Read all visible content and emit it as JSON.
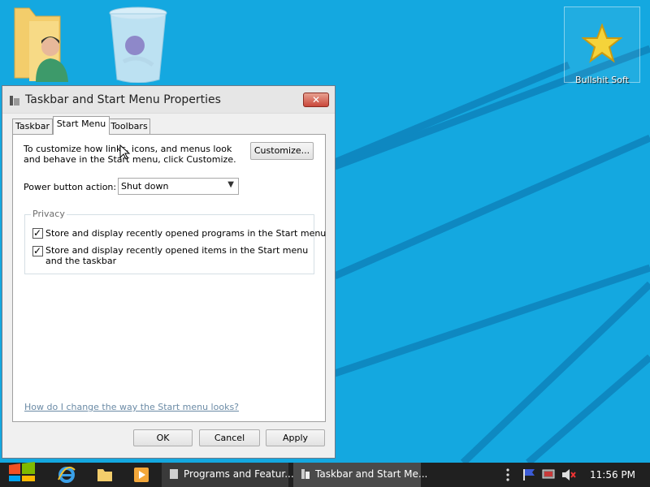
{
  "desktop": {
    "icons": [
      {
        "name": "user-folder"
      },
      {
        "name": "recycle-bin"
      },
      {
        "name": "bullshit-soft",
        "label": "Bullshit Soft"
      }
    ]
  },
  "window": {
    "title": "Taskbar and Start Menu Properties",
    "close_label": "✕",
    "tabs": [
      {
        "label": "Taskbar",
        "active": false
      },
      {
        "label": "Start Menu",
        "active": true
      },
      {
        "label": "Toolbars",
        "active": false
      }
    ],
    "description": "To customize how links, icons, and menus look and behave in the Start menu, click Customize.",
    "customize_label": "Customize...",
    "power_label": "Power button action:",
    "power_value": "Shut down",
    "privacy": {
      "legend": "Privacy",
      "options": [
        {
          "label": "Store and display recently opened programs in the Start menu",
          "checked": true
        },
        {
          "label": "Store and display recently opened items in the Start menu and the taskbar",
          "checked": true
        }
      ]
    },
    "help_link": "How do I change the way the Start menu looks?",
    "buttons": {
      "ok": "OK",
      "cancel": "Cancel",
      "apply": "Apply"
    }
  },
  "taskbar": {
    "pinned": [
      "start-icon",
      "internet-explorer-icon",
      "file-explorer-icon",
      "media-player-icon"
    ],
    "tasks": [
      {
        "label": "Programs and Featur..."
      },
      {
        "label": "Taskbar and Start Me..."
      }
    ],
    "tray": [
      "overflow-icon",
      "action-center-flag-icon",
      "network-icon",
      "volume-muted-icon"
    ],
    "clock": "11:56 PM"
  },
  "colors": {
    "desktop_bg": "#14a8e0",
    "taskbar_bg": "#202020",
    "close_button": "#c9473a",
    "link": "#6b8ba6"
  }
}
